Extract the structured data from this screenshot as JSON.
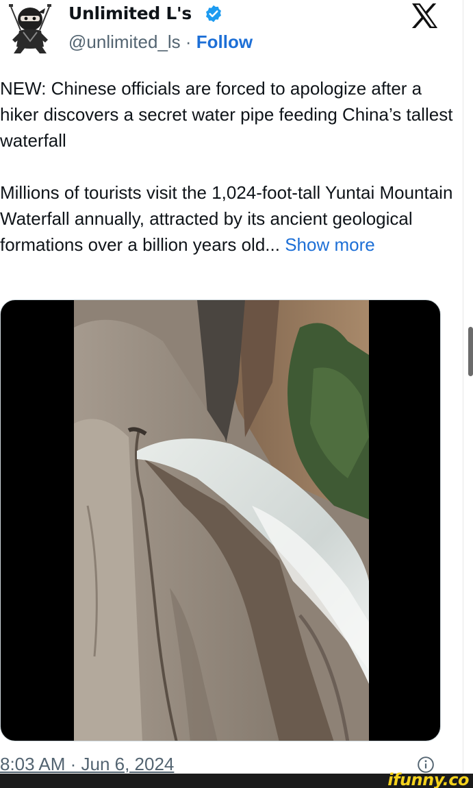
{
  "header": {
    "display_name": "Unlimited L's",
    "handle": "@unlimited_ls",
    "separator": " · ",
    "follow_label": "Follow",
    "verified_color": "#1d9bf0"
  },
  "tweet": {
    "paragraph1": "NEW: Chinese officials are forced to apologize after a hiker discovers a secret water pipe feeding China’s tallest waterfall",
    "paragraph2": "Millions of tourists visit the 1,024-foot-tall Yuntai Mountain Waterfall annually, attracted by its ancient geological formations over a billion years old... ",
    "show_more_label": "Show more"
  },
  "media": {
    "icon": "video-thumbnail-waterfall"
  },
  "footer": {
    "timestamp": "8:03 AM · Jun 6, 2024",
    "info_icon": "info-icon"
  },
  "watermark": {
    "text": "ifunny.co",
    "color": "#f5d21c"
  },
  "colors": {
    "link": "#1d6fd6",
    "text": "#0f1419",
    "secondary": "#536471"
  }
}
